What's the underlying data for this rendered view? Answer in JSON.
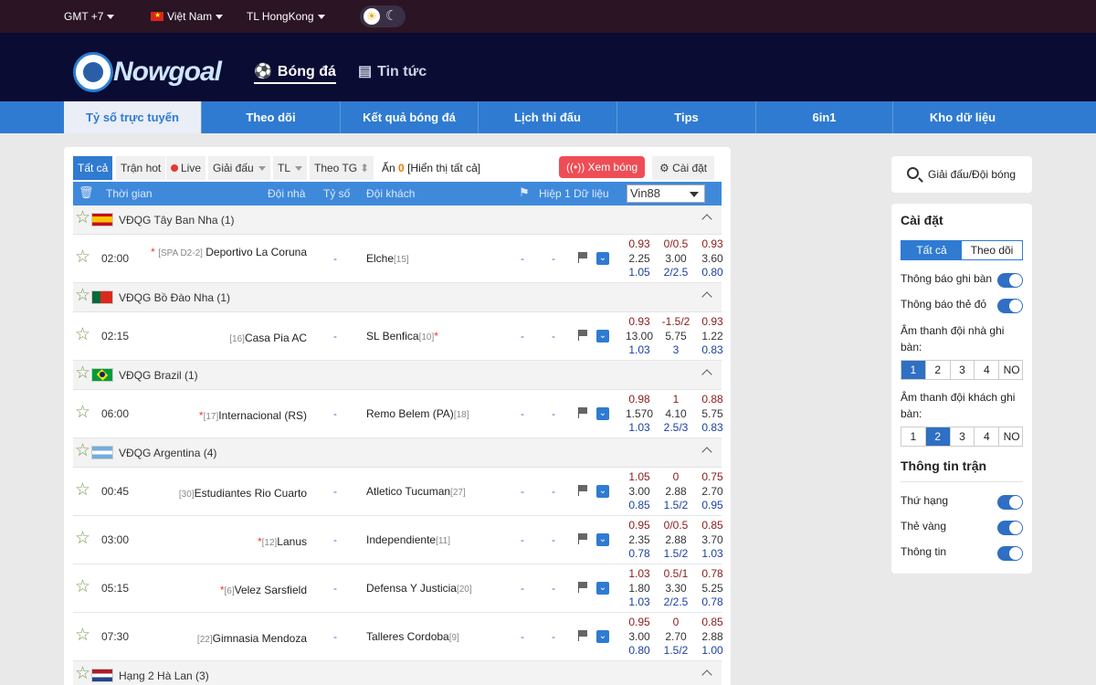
{
  "topbar": {
    "timezone": "GMT +7",
    "country": "Việt Nam",
    "odds_format": "TL HongKong"
  },
  "header": {
    "logo_text": "Nowgoal",
    "nav": [
      {
        "label": "Bóng đá",
        "icon": "soccer-ball-icon"
      },
      {
        "label": "Tin tức",
        "icon": "newspaper-icon"
      }
    ]
  },
  "main_nav": [
    "Tỷ số trực tuyến",
    "Theo dõi",
    "Kết quả bóng đá",
    "Lịch thi đấu",
    "Tips",
    "6in1",
    "Kho dữ liệu"
  ],
  "filters": {
    "all": "Tất cả",
    "hot": "Trận hot",
    "live": "Live",
    "league": "Giải đấu",
    "tl": "TL",
    "by_time": "Theo TG",
    "hidden_prefix": "Ẩn",
    "hidden_count": "0",
    "show_all": "[Hiển thị tất cả]",
    "watch": "Xem bóng",
    "settings": "Cài đặt"
  },
  "table_header": {
    "time": "Thời gian",
    "home": "Đội nhà",
    "score": "Tỷ số",
    "away": "Đội khách",
    "half": "Hiệp 1",
    "data": "Dữ liệu",
    "bookmaker": "Vin88"
  },
  "leagues": [
    {
      "name": "VĐQG Tây Ban Nha (1)",
      "flag": "spain"
    },
    {
      "name": "VĐQG Bồ Đào Nha (1)",
      "flag": "portugal"
    },
    {
      "name": "VĐQG Brazil (1)",
      "flag": "brazil"
    },
    {
      "name": "VĐQG Argentina (4)",
      "flag": "argentina"
    },
    {
      "name": "Hạng 2 Hà Lan (3)",
      "flag": "netherlands"
    }
  ],
  "matches": [
    {
      "time": "02:00",
      "home_tag": "[SPA D2-2]",
      "home": "Deportivo La Coruna",
      "home_rank": "",
      "home_red": "*",
      "score": "-",
      "away": "Elche",
      "away_rank": "[15]",
      "away_red": "",
      "h1": "-",
      "dl": "-",
      "o1": [
        "0.93",
        "2.25",
        "1.05"
      ],
      "o2": [
        "0/0.5",
        "3.00",
        "2/2.5"
      ],
      "o3": [
        "0.93",
        "3.60",
        "0.80"
      ]
    },
    {
      "time": "02:15",
      "home_tag": "",
      "home": "Casa Pia AC",
      "home_rank": "[16]",
      "home_red": "",
      "score": "-",
      "away": "SL Benfica",
      "away_rank": "[10]",
      "away_red": "*",
      "h1": "-",
      "dl": "-",
      "o1": [
        "0.93",
        "13.00",
        "1.03"
      ],
      "o2": [
        "-1.5/2",
        "5.75",
        "3"
      ],
      "o3": [
        "0.93",
        "1.22",
        "0.83"
      ]
    },
    {
      "time": "06:00",
      "home_tag": "",
      "home": "Internacional (RS)",
      "home_rank": "[17]",
      "home_red": "*",
      "score": "-",
      "away": "Remo Belem (PA)",
      "away_rank": "[18]",
      "away_red": "",
      "h1": "-",
      "dl": "-",
      "o1": [
        "0.98",
        "1.570",
        "1.03"
      ],
      "o2": [
        "1",
        "4.10",
        "2.5/3"
      ],
      "o3": [
        "0.88",
        "5.75",
        "0.83"
      ]
    },
    {
      "time": "00:45",
      "home_tag": "",
      "home": "Estudiantes Rio Cuarto",
      "home_rank": "[30]",
      "home_red": "",
      "score": "-",
      "away": "Atletico Tucuman",
      "away_rank": "[27]",
      "away_red": "",
      "h1": "-",
      "dl": "-",
      "o1": [
        "1.05",
        "3.00",
        "0.85"
      ],
      "o2": [
        "0",
        "2.88",
        "1.5/2"
      ],
      "o3": [
        "0.75",
        "2.70",
        "0.95"
      ]
    },
    {
      "time": "03:00",
      "home_tag": "",
      "home": "Lanus",
      "home_rank": "[12]",
      "home_red": "*",
      "score": "-",
      "away": "Independiente",
      "away_rank": "[11]",
      "away_red": "",
      "h1": "-",
      "dl": "-",
      "o1": [
        "0.95",
        "2.35",
        "0.78"
      ],
      "o2": [
        "0/0.5",
        "2.88",
        "1.5/2"
      ],
      "o3": [
        "0.85",
        "3.70",
        "1.03"
      ]
    },
    {
      "time": "05:15",
      "home_tag": "",
      "home": "Velez Sarsfield",
      "home_rank": "[6]",
      "home_red": "*",
      "score": "-",
      "away": "Defensa Y Justicia",
      "away_rank": "[20]",
      "away_red": "",
      "h1": "-",
      "dl": "-",
      "o1": [
        "1.03",
        "1.80",
        "1.03"
      ],
      "o2": [
        "0.5/1",
        "3.30",
        "2/2.5"
      ],
      "o3": [
        "0.78",
        "5.25",
        "0.78"
      ]
    },
    {
      "time": "07:30",
      "home_tag": "",
      "home": "Gimnasia Mendoza",
      "home_rank": "[22]",
      "home_red": "",
      "score": "-",
      "away": "Talleres Cordoba",
      "away_rank": "[9]",
      "away_red": "",
      "h1": "-",
      "dl": "-",
      "o1": [
        "0.95",
        "3.00",
        "0.80"
      ],
      "o2": [
        "0",
        "2.70",
        "1.5/2"
      ],
      "o3": [
        "0.85",
        "2.88",
        "1.00"
      ]
    }
  ],
  "sidebar": {
    "search_label": "Giải đấu/Đội bóng",
    "settings_title": "Cài đặt",
    "seg_all": "Tất cả",
    "seg_follow": "Theo dõi",
    "goal_notify": "Thông báo ghi bàn",
    "red_notify": "Thông báo thẻ đỏ",
    "home_sound": "Âm thanh đội nhà ghi bàn:",
    "away_sound": "Âm thanh đội khách ghi bàn:",
    "sound_options": [
      "1",
      "2",
      "3",
      "4",
      "NO"
    ],
    "home_sound_selected": "1",
    "away_sound_selected": "2",
    "match_info_title": "Thông tin trận",
    "rank": "Thứ hạng",
    "yellow": "Thẻ vàng",
    "info": "Thông tin"
  },
  "colors": {
    "accent": "#2f7bd1",
    "topbar": "#2b1424",
    "header": "#0a0c33",
    "watch": "#ef4d55"
  }
}
